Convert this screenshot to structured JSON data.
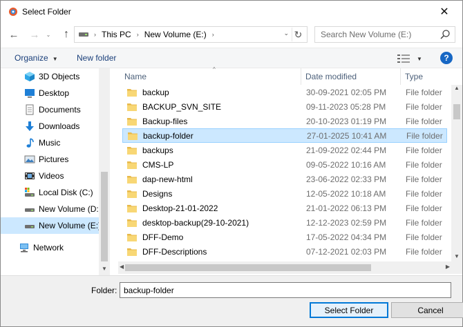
{
  "window": {
    "title": "Select Folder",
    "close_glyph": "✕"
  },
  "nav": {
    "back_glyph": "←",
    "forward_glyph": "→",
    "recent_glyph": "⌄",
    "up_glyph": "↑",
    "address": {
      "segments": [
        "This PC",
        "New Volume (E:)"
      ],
      "sep_glyph": "›",
      "dropdown_glyph": "⌄",
      "refresh_glyph": "↻"
    },
    "search": {
      "placeholder": "Search New Volume (E:)"
    }
  },
  "toolbar": {
    "organize_label": "Organize",
    "organize_caret": "▼",
    "new_folder_label": "New folder",
    "view_caret": "▼",
    "help_label": "?"
  },
  "sidebar": {
    "items": [
      {
        "label": "3D Objects",
        "icon": "cube-icon"
      },
      {
        "label": "Desktop",
        "icon": "desktop-icon"
      },
      {
        "label": "Documents",
        "icon": "documents-icon"
      },
      {
        "label": "Downloads",
        "icon": "download-icon"
      },
      {
        "label": "Music",
        "icon": "music-icon"
      },
      {
        "label": "Pictures",
        "icon": "pictures-icon"
      },
      {
        "label": "Videos",
        "icon": "videos-icon"
      },
      {
        "label": "Local Disk (C:)",
        "icon": "local-disk-icon"
      },
      {
        "label": "New Volume (D:)",
        "icon": "drive-icon"
      },
      {
        "label": "New Volume (E:)",
        "icon": "drive-icon",
        "selected": true
      },
      {
        "label": "Network",
        "icon": "network-icon"
      }
    ],
    "scroll_down_glyph": "▼"
  },
  "filelist": {
    "columns": {
      "name": "Name",
      "date": "Date modified",
      "type": "Type"
    },
    "sort_glyph": "^",
    "rows": [
      {
        "name": "backup",
        "date": "30-09-2021 02:05 PM",
        "type": "File folder"
      },
      {
        "name": "BACKUP_SVN_SITE",
        "date": "09-11-2023 05:28 PM",
        "type": "File folder"
      },
      {
        "name": "Backup-files",
        "date": "20-10-2023 01:19 PM",
        "type": "File folder"
      },
      {
        "name": "backup-folder",
        "date": "27-01-2025 10:41 AM",
        "type": "File folder",
        "selected": true
      },
      {
        "name": "backups",
        "date": "21-09-2022 02:44 PM",
        "type": "File folder"
      },
      {
        "name": "CMS-LP",
        "date": "09-05-2022 10:16 AM",
        "type": "File folder"
      },
      {
        "name": "dap-new-html",
        "date": "23-06-2022 02:33 PM",
        "type": "File folder"
      },
      {
        "name": "Designs",
        "date": "12-05-2022 10:18 AM",
        "type": "File folder"
      },
      {
        "name": "Desktop-21-01-2022",
        "date": "21-01-2022 06:13 PM",
        "type": "File folder"
      },
      {
        "name": "desktop-backup(29-10-2021)",
        "date": "12-12-2023 02:59 PM",
        "type": "File folder"
      },
      {
        "name": "DFF-Demo",
        "date": "17-05-2022 04:34 PM",
        "type": "File folder"
      },
      {
        "name": "DFF-Descriptions",
        "date": "07-12-2021 02:03 PM",
        "type": "File folder"
      }
    ],
    "scroll_up_glyph": "▲",
    "scroll_down_glyph": "▼",
    "scroll_left_glyph": "◀",
    "scroll_right_glyph": "▶"
  },
  "footer": {
    "folder_label": "Folder:",
    "folder_value": "backup-folder",
    "select_label": "Select Folder",
    "cancel_label": "Cancel"
  },
  "colors": {
    "selection": "#cce8ff",
    "accent": "#0078d7",
    "folder": "#f8d775"
  }
}
